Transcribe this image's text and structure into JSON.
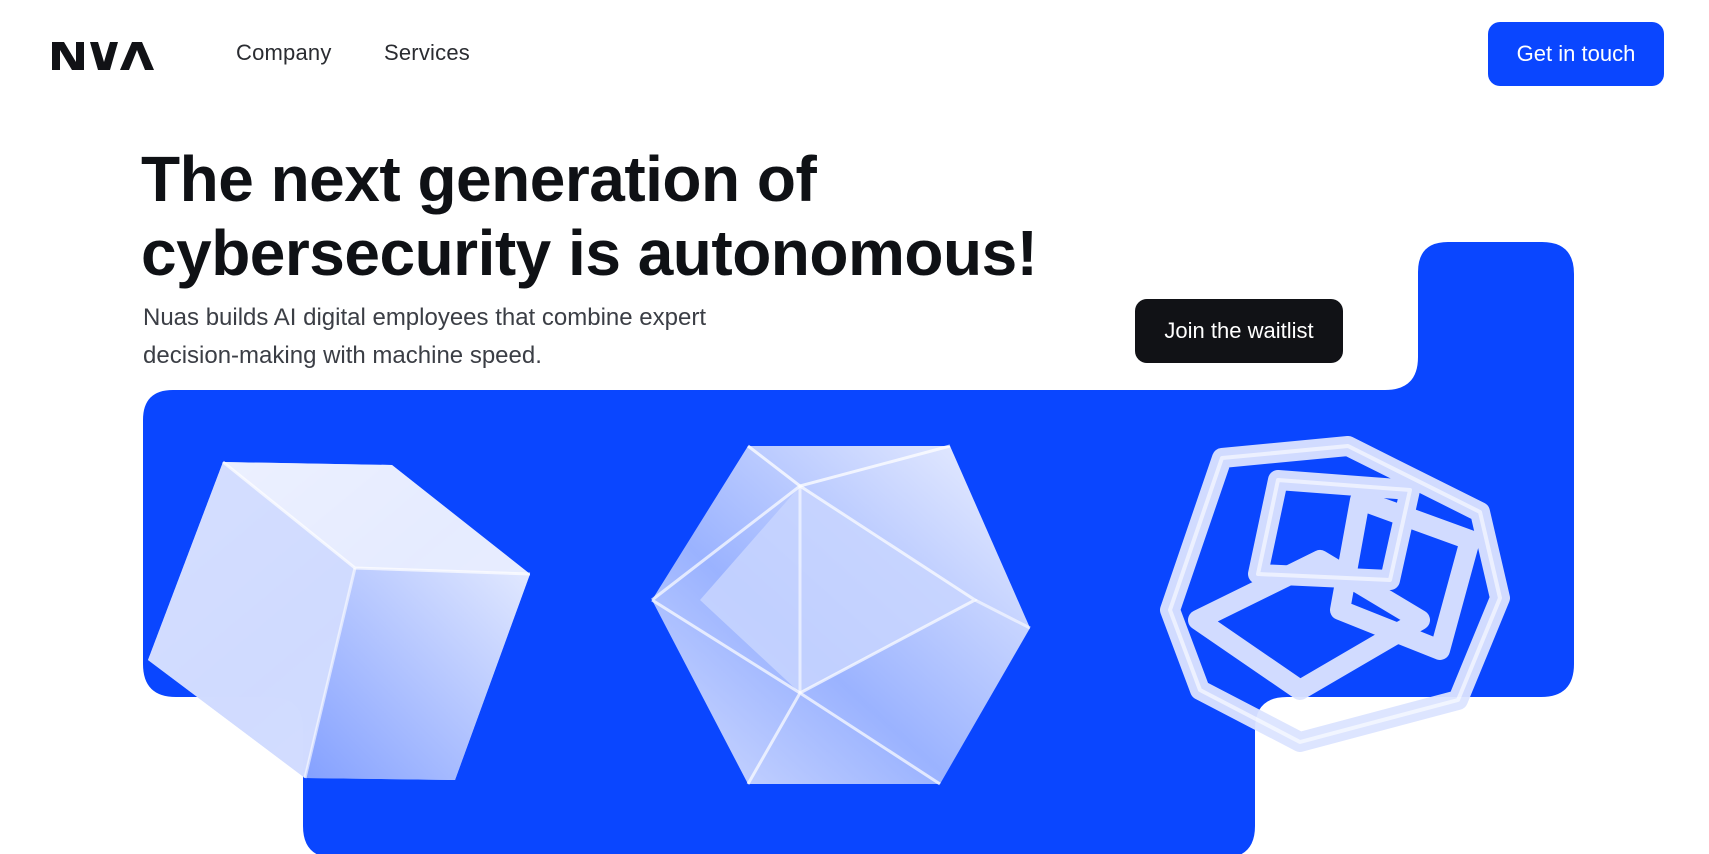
{
  "brand": {
    "name": "NUA",
    "logo_icon": "nua-logo-icon"
  },
  "nav": {
    "links": [
      {
        "label": "Company"
      },
      {
        "label": "Services"
      }
    ],
    "cta_label": "Get in touch"
  },
  "hero": {
    "headline_line1": "The next generation of",
    "headline_line2": "cybersecurity is autonomous!",
    "subtitle_line1": "Nuas builds AI digital employees that combine expert",
    "subtitle_line2": "decision-making with machine speed.",
    "waitlist_label": "Join the waitlist"
  },
  "visuals": {
    "shapes": [
      "glass-cube-icon",
      "glass-icosahedron-icon",
      "glass-lattice-cube-icon"
    ]
  },
  "colors": {
    "accent": "#0a46ff",
    "dark_button": "#111216",
    "text": "#0f1115",
    "glass": "#c9d6ff"
  }
}
